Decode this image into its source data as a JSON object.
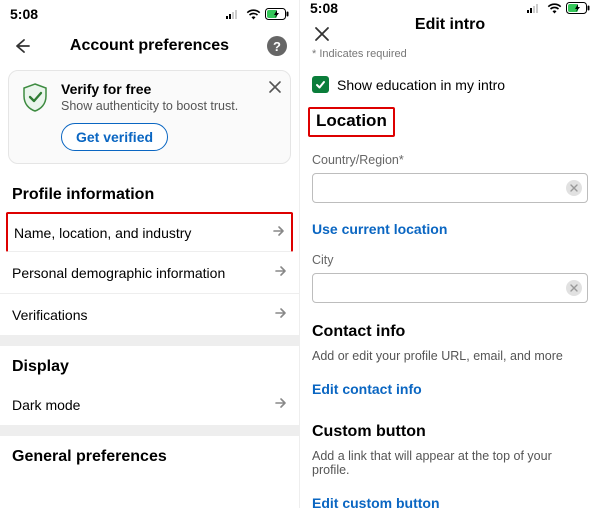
{
  "status": {
    "time": "5:08"
  },
  "left": {
    "title": "Account preferences",
    "verify": {
      "title": "Verify for free",
      "sub": "Show authenticity to boost trust.",
      "button": "Get verified"
    },
    "sections": {
      "profile_info": "Profile information",
      "display": "Display",
      "general_prefs": "General preferences"
    },
    "rows": {
      "name_loc": "Name, location, and industry",
      "demo": "Personal demographic information",
      "verifications": "Verifications",
      "dark_mode": "Dark mode"
    }
  },
  "right": {
    "title": "Edit intro",
    "required_note": "* Indicates required",
    "show_edu": "Show education in my intro",
    "location_heading": "Location",
    "country_label": "Country/Region*",
    "use_current": "Use current location",
    "city_label": "City",
    "contact": {
      "title": "Contact info",
      "sub": "Add or edit your profile URL, email, and more",
      "action": "Edit contact info"
    },
    "custom": {
      "title": "Custom button",
      "sub": "Add a link that will appear at the top of your profile.",
      "action": "Edit custom button"
    }
  }
}
